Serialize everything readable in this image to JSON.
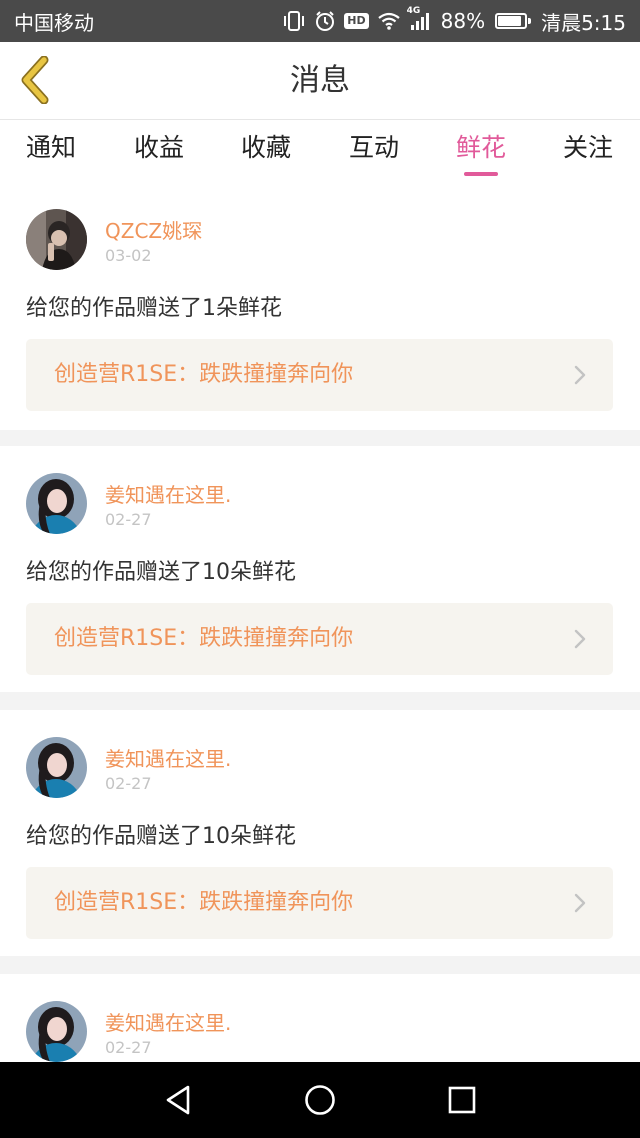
{
  "status_bar": {
    "carrier": "中国移动",
    "network": "4G",
    "battery_percent": "88%",
    "battery_level": 0.88,
    "time": "清晨5:15",
    "hd_label": "HD",
    "icons": [
      "vibrate-icon",
      "alarm-icon",
      "hd-icon",
      "wifi-icon",
      "signal-icon",
      "battery-icon"
    ]
  },
  "header": {
    "title": "消息",
    "back_icon": "chevron-left-icon"
  },
  "tabs": [
    {
      "label": "通知",
      "active": false
    },
    {
      "label": "收益",
      "active": false
    },
    {
      "label": "收藏",
      "active": false
    },
    {
      "label": "互动",
      "active": false
    },
    {
      "label": "鲜花",
      "active": true
    },
    {
      "label": "关注",
      "active": false
    }
  ],
  "feed": {
    "items": [
      {
        "username": "QZCZ姚琛",
        "date": "03-02",
        "message": "给您的作品赠送了1朵鲜花",
        "work_title": "创造营R1SE：跌跌撞撞奔向你"
      },
      {
        "username": "姜知遇在这里.",
        "date": "02-27",
        "message": "给您的作品赠送了10朵鲜花",
        "work_title": "创造营R1SE：跌跌撞撞奔向你"
      },
      {
        "username": "姜知遇在这里.",
        "date": "02-27",
        "message": "给您的作品赠送了10朵鲜花",
        "work_title": "创造营R1SE：跌跌撞撞奔向你"
      },
      {
        "username": "姜知遇在这里.",
        "date": "02-27"
      }
    ]
  },
  "colors": {
    "accent_pink": "#e15a9a",
    "accent_orange": "#f0945a",
    "back_icon_yellow": "#e8c542",
    "status_bar_bg": "#4a4a4a",
    "link_bg": "#f6f4ef"
  },
  "nav_bar": {
    "icons": [
      "back-triangle-icon",
      "home-circle-icon",
      "recents-square-icon"
    ]
  }
}
